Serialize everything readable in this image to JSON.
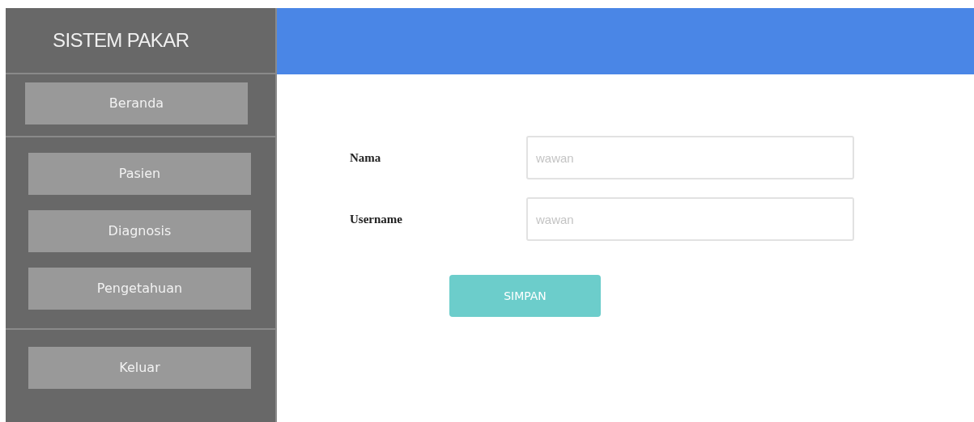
{
  "sidebar": {
    "title": "SISTEM PAKAR",
    "groups": [
      {
        "items": [
          "Beranda"
        ]
      },
      {
        "items": [
          "Pasien",
          "Diagnosis",
          "Pengetahuan"
        ]
      },
      {
        "items": [
          "Keluar"
        ]
      }
    ]
  },
  "form": {
    "fields": [
      {
        "label": "Nama",
        "placeholder": "wawan"
      },
      {
        "label": "Username",
        "placeholder": "wawan"
      }
    ],
    "submit": "SIMPAN"
  }
}
